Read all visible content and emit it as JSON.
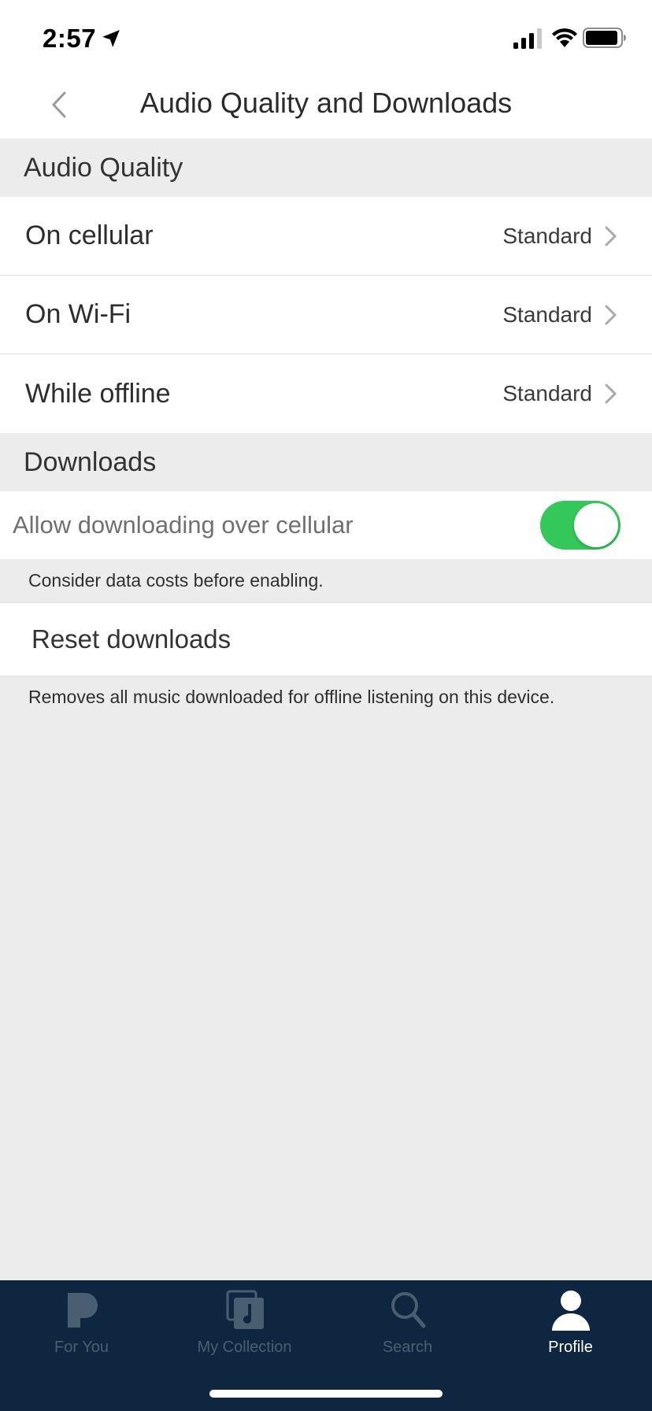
{
  "status": {
    "time": "2:57"
  },
  "nav": {
    "title": "Audio Quality and Downloads"
  },
  "audio_quality": {
    "header": "Audio Quality",
    "rows": [
      {
        "label": "On cellular",
        "value": "Standard"
      },
      {
        "label": "On Wi-Fi",
        "value": "Standard"
      },
      {
        "label": "While offline",
        "value": "Standard"
      }
    ]
  },
  "downloads": {
    "header": "Downloads",
    "allow_cellular_label": "Allow downloading over cellular",
    "allow_cellular_on": true,
    "allow_cellular_note": "Consider data costs before enabling.",
    "reset_label": "Reset downloads",
    "reset_note": "Removes all music downloaded for offline listening on this device."
  },
  "tab_bar": {
    "tabs": [
      {
        "label": "For You",
        "icon": "pandora-icon",
        "active": false
      },
      {
        "label": "My Collection",
        "icon": "collection-icon",
        "active": false
      },
      {
        "label": "Search",
        "icon": "search-icon",
        "active": false
      },
      {
        "label": "Profile",
        "icon": "profile-icon",
        "active": true
      }
    ]
  },
  "colors": {
    "toggle_on": "#34c759",
    "tab_bar_bg": "#0f2640",
    "tab_inactive": "#4a5e72",
    "tab_active": "#ffffff"
  }
}
